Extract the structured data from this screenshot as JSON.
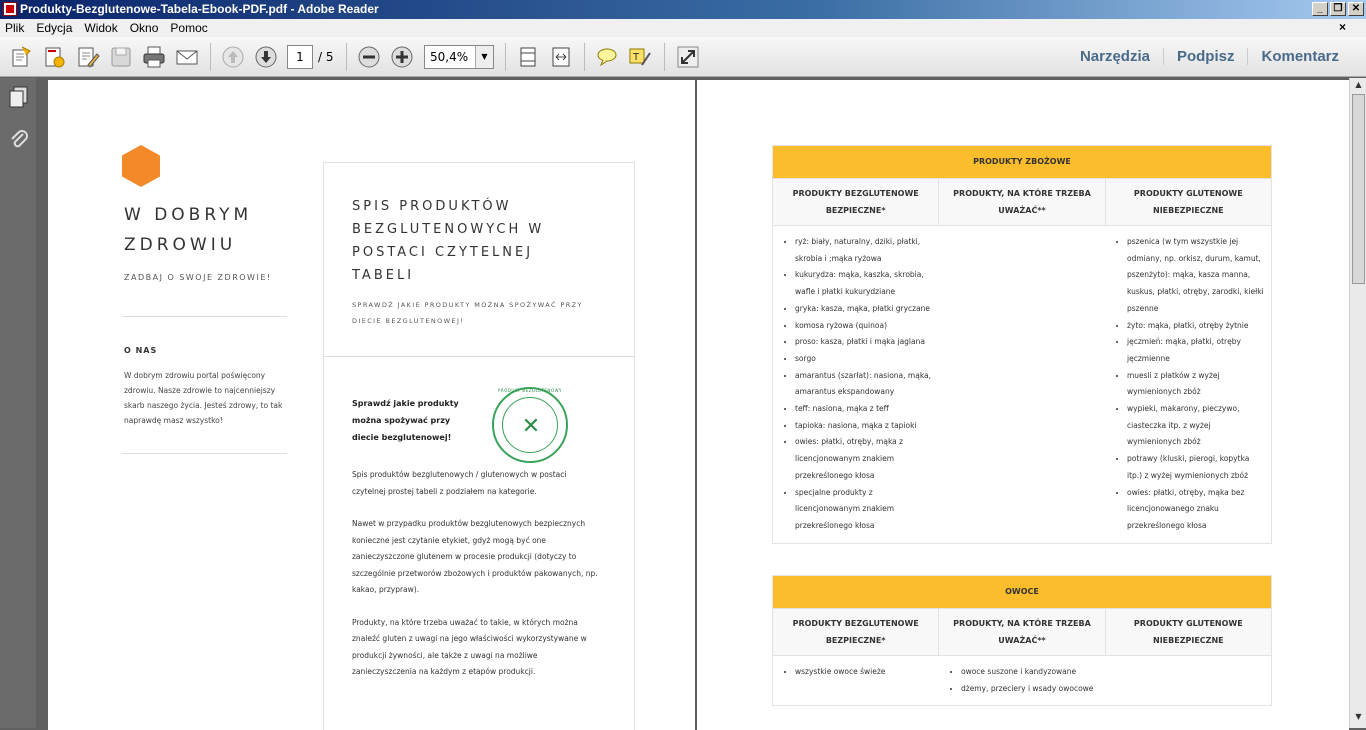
{
  "window": {
    "title": "Produkty-Bezglutenowe-Tabela-Ebook-PDF.pdf - Adobe Reader",
    "btn_min": "_",
    "btn_max": "❐",
    "btn_close": "✕"
  },
  "menu": {
    "items": [
      "Plik",
      "Edycja",
      "Widok",
      "Okno",
      "Pomoc"
    ],
    "close": "×"
  },
  "toolbar": {
    "page_current": "1",
    "page_total": "/ 5",
    "zoom": "50,4%",
    "zoom_arrow": "▼",
    "links": [
      "Narzędzia",
      "Podpisz",
      "Komentarz"
    ]
  },
  "page1": {
    "brand": "W DOBRYM ZDROWIU",
    "tagline": "ZADBAJ O SWOJE ZDROWIE!",
    "about_heading": "O NAS",
    "about_text": "W dobrym zdrowiu portal poświęcony zdrowiu. Nasze zdrowie to najcenniejszy skarb naszego życia. Jesteś zdrowy, to tak naprawdę masz wszystko!",
    "card_title": "SPIS PRODUKTÓW BEZGLUTENOWYCH W POSTACI CZYTELNEJ TABELI",
    "card_subtitle": "SPRAWDŹ JAKIE PRODUKTY MOŻNA SPOŻYWAĆ PRZY DIECIE BEZGLUTENOWEJ!",
    "lead": "Sprawdź jakie produkty można spożywać przy diecie bezglutenowej!",
    "badge_text": "PRODUKT BEZGLUTENOWY",
    "paragraphs": [
      "Spis produktów bezglutenowych / glutenowych w postaci czytelnej prostej tabeli z podziałem na kategorie.",
      "Nawet w przypadku produktów bezglutenowych bezpiecznych konieczne jest czytanie etykiet, gdyż mogą być one zanieczyszczone glutenem w procesie produkcji (dotyczy to szczególnie przetworów zbożowych i produktów pakowanych, np. kakao, przypraw).",
      "Produkty, na które trzeba uważać to takie, w których można znaleźć gluten z uwagi na jego właściwości wykorzystywane w produkcji żywności, ale także z uwagi na możliwe zanieczyszczenia na każdym z etapów produkcji."
    ]
  },
  "page2": {
    "tables": [
      {
        "heading": "PRODUKTY ZBOŻOWE",
        "columns": [
          "PRODUKTY BEZGLUTENOWE BEZPIECZNE*",
          "PRODUKTY, NA KTÓRE TRZEBA UWAŻAĆ**",
          "PRODUKTY GLUTENOWE NIEBEZPIECZNE"
        ],
        "col1": [
          "ryż: biały, naturalny, dziki, płatki, skrobia i ;mąka ryżowa",
          "kukurydza: mąka, kaszka, skrobia, wafle i płatki kukurydziane",
          "gryka: kasza, mąka, płatki gryczane",
          "komosa ryżowa (quinoa)",
          "proso: kasza, płatki i mąka jaglana",
          "sorgo",
          "amarantus (szarłat): nasiona, mąka, amarantus ekspandowany",
          "teff: nasiona, mąka z teff",
          "tapioka: nasiona, mąka z tapioki",
          "owies: płatki, otręby, mąka z licencjonowanym znakiem przekreślonego kłosa",
          "specjalne produkty z licencjonowanym znakiem przekreślonego kłosa"
        ],
        "col2": [],
        "col3": [
          "pszenica (w tym wszystkie jej odmiany, np. orkisz, durum, kamut, pszenżyto): mąka, kasza manna, kuskus, płatki, otręby, zarodki, kiełki pszenne",
          "żyto: mąka, płatki, otręby żytnie",
          "jęczmień: mąka, płatki, otręby jęczmienne",
          "muesli z płatków z wyżej wymienionych zbóż",
          "wypieki, makarony, pieczywo, ciasteczka itp. z wyżej wymienionych zbóż",
          "potrawy (kluski, pierogi, kopytka itp.) z wyżej wymienionych zbóż",
          "owies: płatki, otręby, mąka bez licencjonowanego znaku przekreślonego kłosa"
        ]
      },
      {
        "heading": "OWOCE",
        "columns": [
          "PRODUKTY BEZGLUTENOWE BEZPIECZNE*",
          "PRODUKTY, NA KTÓRE TRZEBA UWAŻAĆ**",
          "PRODUKTY GLUTENOWE NIEBEZPIECZNE"
        ],
        "col1": [
          "wszystkie owoce świeże"
        ],
        "col2": [
          "owoce suszone i kandyzowane",
          "dżemy, przeciery i wsady owocowe"
        ],
        "col3": []
      }
    ]
  }
}
